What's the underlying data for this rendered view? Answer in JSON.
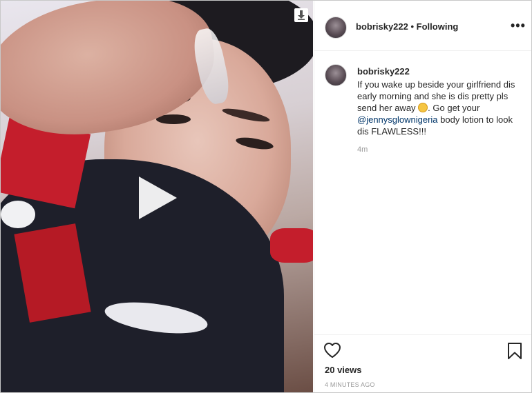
{
  "post": {
    "username": "bobrisky222",
    "follow_status": "Following",
    "more_icon": "more-options-icon"
  },
  "caption": {
    "username": "bobrisky222",
    "text_part1": "If you wake up beside your girlfriend dis early morning and she is dis pretty pls send her away ",
    "emoji": "laughing-emoji",
    "text_part2": ". Go get your ",
    "mention": "@jennysglownigeria",
    "text_part3": " body lotion to look dis FLAWLESS!!!",
    "time": "4m"
  },
  "footer": {
    "views": "20 views",
    "posted_ago": "4 MINUTES AGO"
  },
  "colors": {
    "text": "#262626",
    "mention": "#003569",
    "muted": "#999999"
  }
}
